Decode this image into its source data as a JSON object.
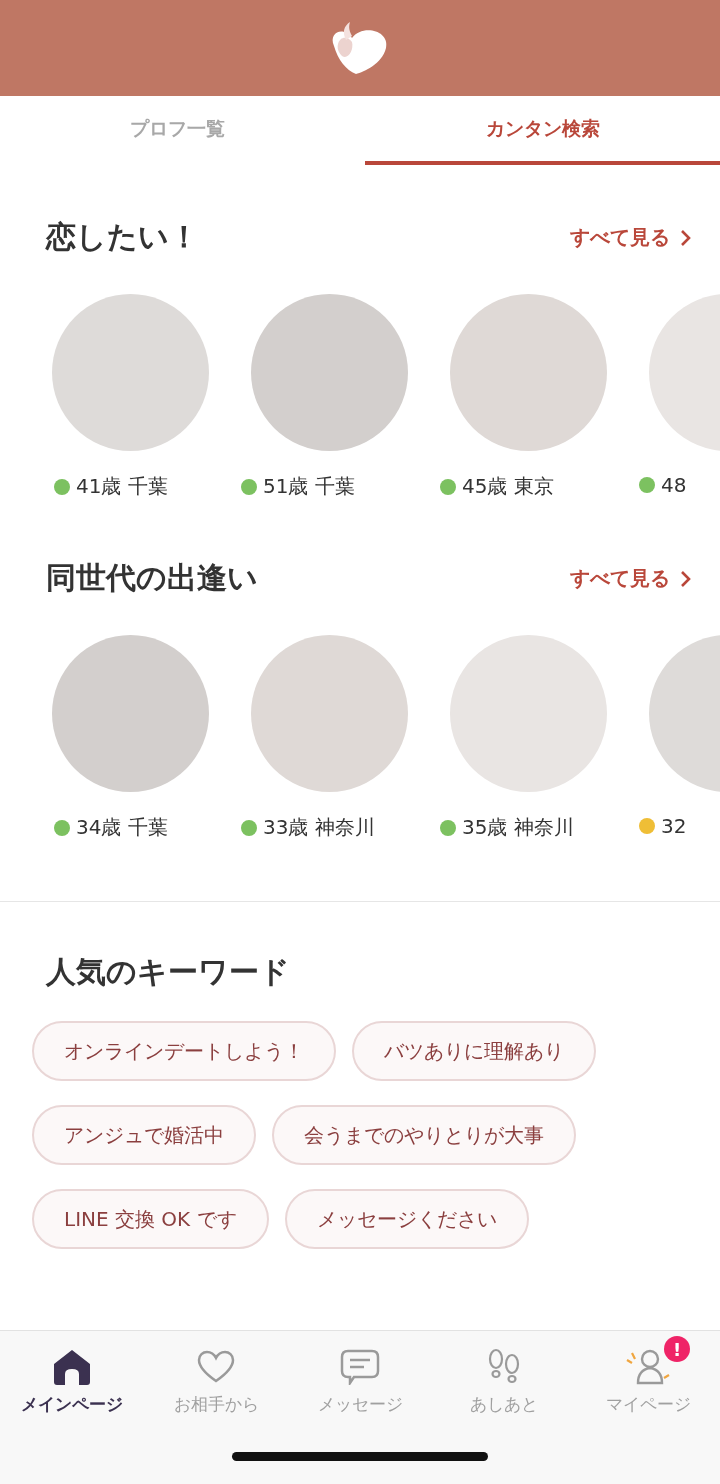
{
  "tabs": [
    {
      "label": "プロフ一覧",
      "selected": false
    },
    {
      "label": "カンタン検索",
      "selected": true
    }
  ],
  "sections": [
    {
      "title": "恋したい！",
      "see_all": "すべて見る",
      "profiles": [
        {
          "label": "41歳 千葉",
          "color": "#7cc160"
        },
        {
          "label": "51歳 千葉",
          "color": "#7cc160"
        },
        {
          "label": "45歳 東京",
          "color": "#7cc160"
        },
        {
          "label": "48",
          "color": "#7cc160"
        }
      ]
    },
    {
      "title": "同世代の出逢い",
      "see_all": "すべて見る",
      "profiles": [
        {
          "label": "34歳 千葉",
          "color": "#7cc160"
        },
        {
          "label": "33歳 神奈川",
          "color": "#7cc160"
        },
        {
          "label": "35歳 神奈川",
          "color": "#7cc160"
        },
        {
          "label": "32",
          "color": "#efbe36"
        }
      ]
    }
  ],
  "keywords": {
    "title": "人気のキーワード",
    "items": [
      [
        "オンラインデートしよう！",
        "バツありに理解あり"
      ],
      [
        "アンジュで婚活中",
        "会うまでのやりとりが大事"
      ],
      [
        "LINE 交換 OK です",
        "メッセージください"
      ]
    ]
  },
  "nav": [
    {
      "label": "メインページ",
      "kind": "home",
      "selected": true,
      "alert": false
    },
    {
      "label": "お相手から",
      "kind": "heart",
      "selected": false,
      "alert": false
    },
    {
      "label": "メッセージ",
      "kind": "message",
      "selected": false,
      "alert": false
    },
    {
      "label": "あしあと",
      "kind": "footprints",
      "selected": false,
      "alert": false
    },
    {
      "label": "マイページ",
      "kind": "person",
      "selected": false,
      "alert": true,
      "alert_mark": "!"
    }
  ]
}
